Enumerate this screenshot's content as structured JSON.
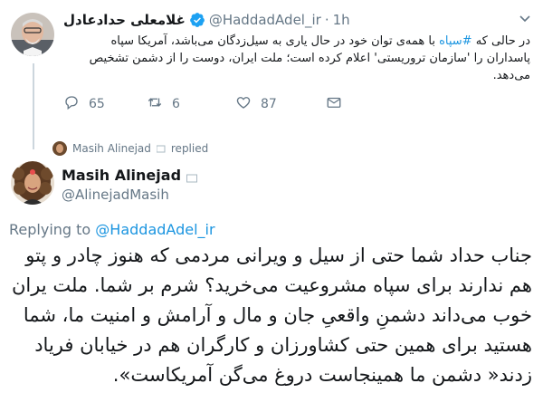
{
  "original_tweet": {
    "author_name": "غلامعلی حدادعادل",
    "handle": "@HaddadAdel_ir",
    "separator": "·",
    "time": "1h",
    "text_before_hashtag": "در حالی که ",
    "hashtag": "#سپاه",
    "text_after_hashtag": " با همه‌ی توان خود در حال یاری به سیل‌زدگان می‌باشد، آمریکا سپاه پاسداران را 'سازمان تروریستی' اعلام کرده است؛ ملت ایران، دوست را از دشمن تشخیص می‌دهد.",
    "replies_count": "65",
    "retweets_count": "6",
    "likes_count": "87",
    "menu_icon": "chevron-down-icon"
  },
  "replied_indicator": {
    "name": "Masih Alinejad",
    "label": "replied"
  },
  "reply_tweet": {
    "author_name": "Masih Alinejad",
    "handle": "@AlinejadMasih",
    "replying_to_label": "Replying to",
    "replying_to_handle": "@HaddadAdel_ir",
    "text": "جناب حداد شما حتی از سیل و ویرانی مردمی که هنوز چادر و پتو هم ندارند برای سپاه مشروعیت می‌خرید؟ شرم بر شما. ملت یران خوب می‌داند دشمنِ واقعیِ جان و مال و آرامش و امنیت ما، شما هستید برای همین حتی کشاورزان و کارگران هم در خیابان فریاد زدند« دشمن ما همینجاست دروغ می‌گن آمریکاست»."
  },
  "colors": {
    "link": "#1b95e0",
    "muted": "#657786",
    "thread_line": "#ccd6dd"
  }
}
